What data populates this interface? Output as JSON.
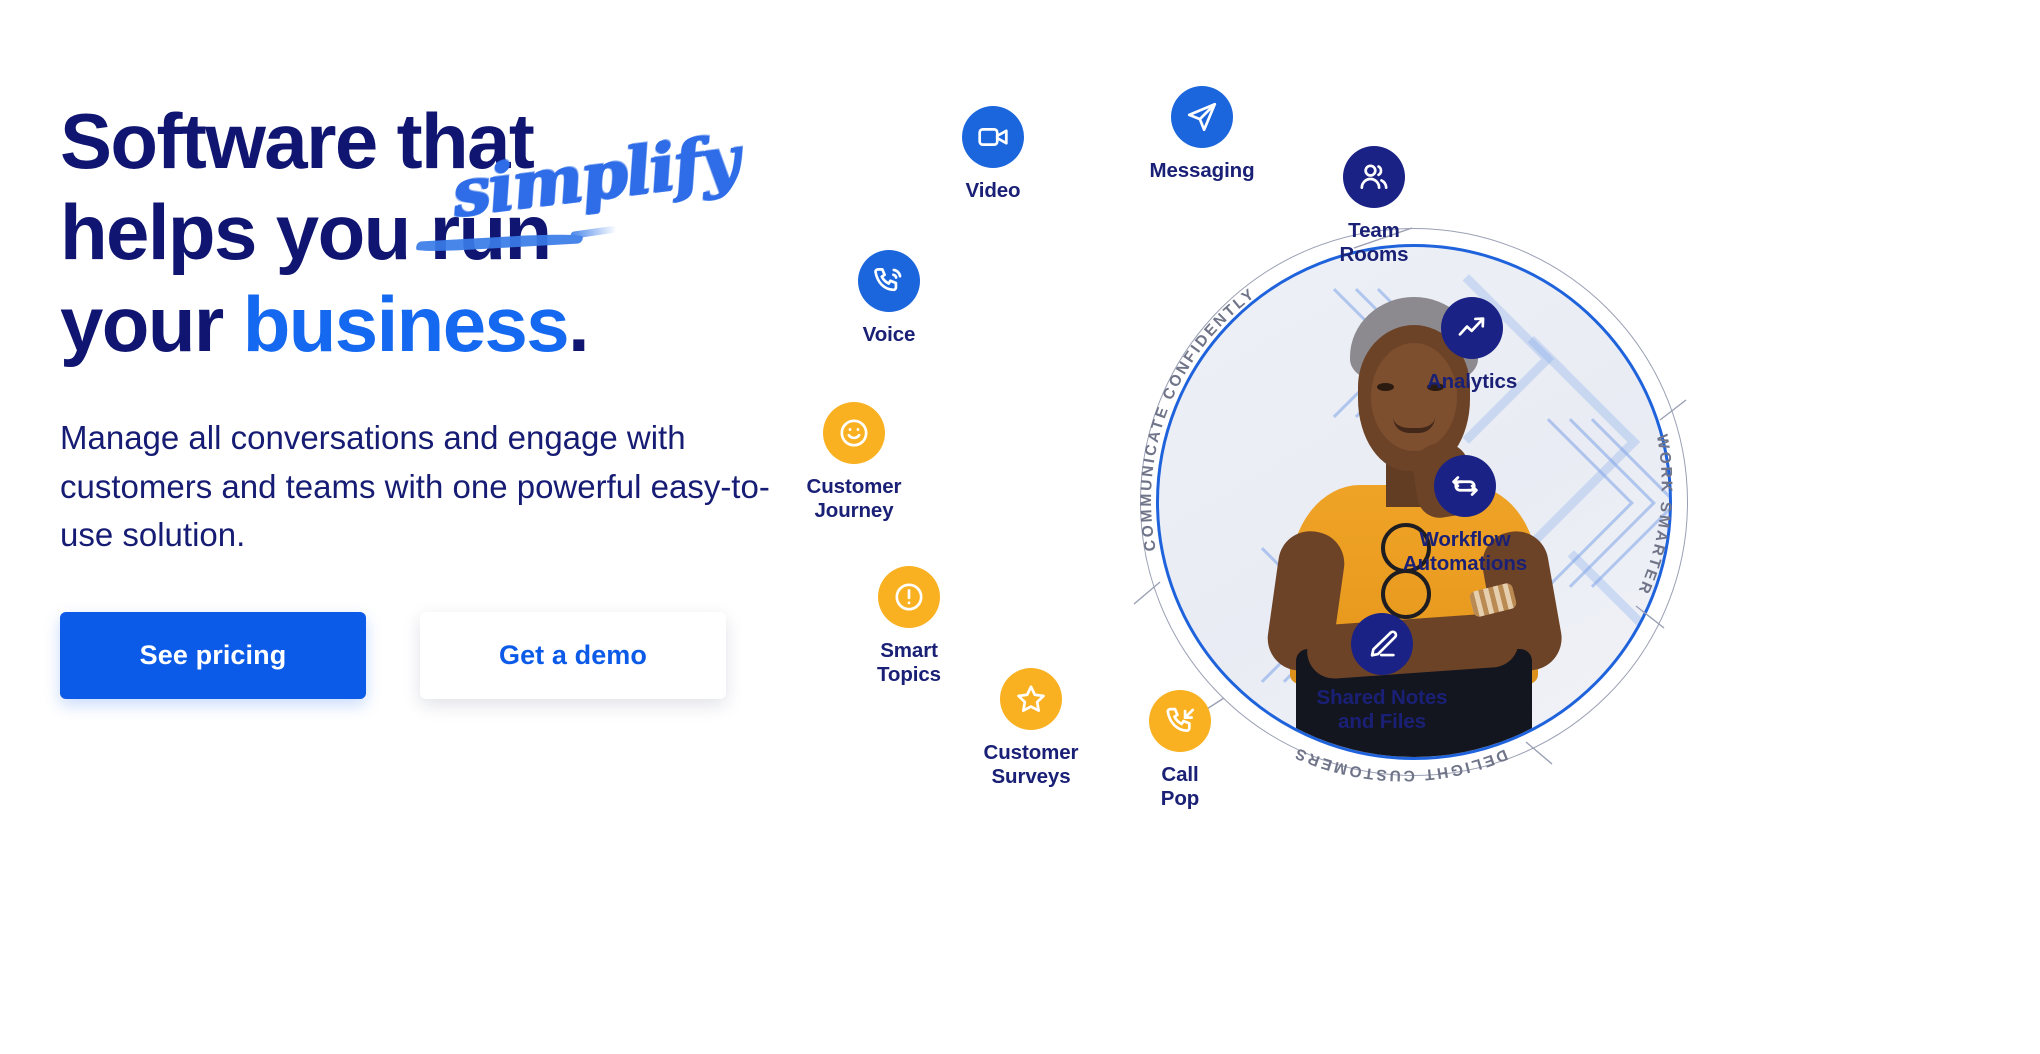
{
  "hero": {
    "headline": {
      "line1": "Software that",
      "line2_prefix": "helps you ",
      "line2_struck": "run",
      "line3_prefix": "your ",
      "line3_accent": "business",
      "line3_suffix": ".",
      "handwritten_overlay": "simplify"
    },
    "subcopy": "Manage all conversations and engage with customers and teams with one powerful easy-to-use solution.",
    "buttons": {
      "primary_label": "See pricing",
      "secondary_label": "Get a demo"
    }
  },
  "diagram": {
    "arcs": [
      {
        "text": "COMMUNICATE CONFIDENTLY",
        "position": "upper-left"
      },
      {
        "text": "WORK SMARTER",
        "position": "right"
      },
      {
        "text": "DELIGHT CUSTOMERS",
        "position": "bottom"
      }
    ],
    "nodes": [
      {
        "label": "Messaging",
        "icon": "paper-plane-icon",
        "color": "#1b66dd",
        "tone": "blue"
      },
      {
        "label": "Team\nRooms",
        "icon": "people-icon",
        "color": "#1b2285",
        "tone": "navy"
      },
      {
        "label": "Analytics",
        "icon": "trend-up-icon",
        "color": "#1b2285",
        "tone": "navy"
      },
      {
        "label": "Workflow\nAutomations",
        "icon": "refresh-loop-icon",
        "color": "#1b2285",
        "tone": "navy"
      },
      {
        "label": "Shared Notes\nand Files",
        "icon": "pencil-icon",
        "color": "#1b2285",
        "tone": "navy"
      },
      {
        "label": "Call\nPop",
        "icon": "incoming-call-icon",
        "color": "#f9b122",
        "tone": "amber"
      },
      {
        "label": "Customer\nSurveys",
        "icon": "star-icon",
        "color": "#f9b122",
        "tone": "amber"
      },
      {
        "label": "Smart\nTopics",
        "icon": "alert-circle-icon",
        "color": "#f9b122",
        "tone": "amber"
      },
      {
        "label": "Customer\nJourney",
        "icon": "smiley-icon",
        "color": "#f9b122",
        "tone": "amber"
      },
      {
        "label": "Voice",
        "icon": "phone-ring-icon",
        "color": "#1b66dd",
        "tone": "blue"
      },
      {
        "label": "Video",
        "icon": "video-camera-icon",
        "color": "#1b66dd",
        "tone": "blue"
      }
    ]
  },
  "colors": {
    "navy": "#0f1570",
    "accent_blue": "#1569f0",
    "button_blue": "#0b5ae8",
    "amber": "#f9b122",
    "icon_navy": "#1b2285",
    "icon_blue": "#1b66dd",
    "background": "#ffffff"
  }
}
